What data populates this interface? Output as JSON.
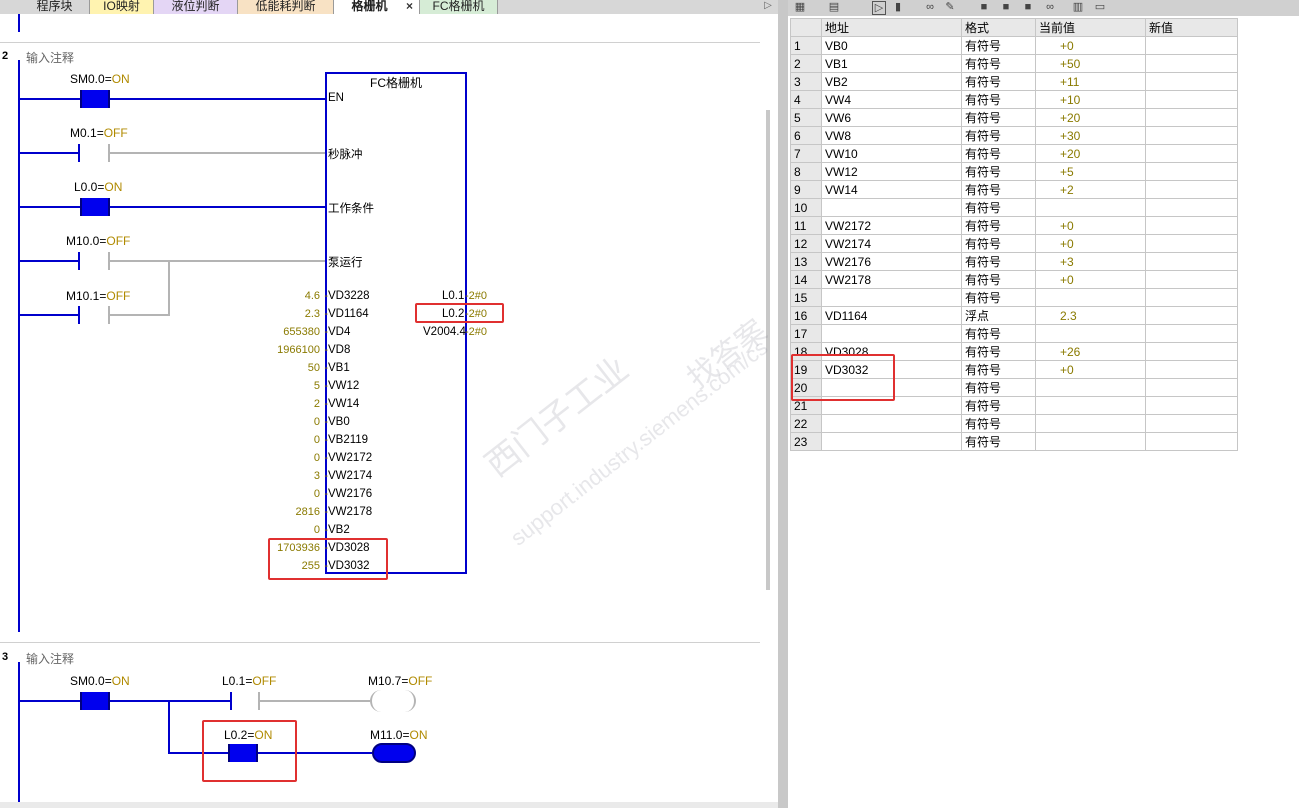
{
  "tabs": [
    {
      "label": "程序块"
    },
    {
      "label": "IO映射"
    },
    {
      "label": "液位判断"
    },
    {
      "label": "低能耗判断"
    },
    {
      "label": "格栅机",
      "close": "×"
    },
    {
      "label": "FC格栅机"
    }
  ],
  "tab_scroll": "▷",
  "networks": [
    {
      "num": "2",
      "comment": "输入注释",
      "contacts": [
        {
          "name": "SM0.0",
          "state": "ON"
        },
        {
          "name": "M0.1",
          "state": "OFF"
        },
        {
          "name": "L0.0",
          "state": "ON"
        },
        {
          "name": "M10.0",
          "state": "OFF"
        },
        {
          "name": "M10.1",
          "state": "OFF"
        }
      ],
      "fc_title": "FC格栅机",
      "inputs": [
        {
          "label": "EN"
        },
        {
          "label": "秒脉冲"
        },
        {
          "label": "工作条件"
        },
        {
          "label": "泵运行"
        }
      ],
      "params_in": [
        {
          "value": "4.6",
          "name": "VD3228"
        },
        {
          "value": "2.3",
          "name": "VD1164"
        },
        {
          "value": "655380",
          "name": "VD4"
        },
        {
          "value": "1966100",
          "name": "VD8"
        },
        {
          "value": "50",
          "name": "VB1"
        },
        {
          "value": "5",
          "name": "VW12"
        },
        {
          "value": "2",
          "name": "VW14"
        },
        {
          "value": "0",
          "name": "VB0"
        },
        {
          "value": "0",
          "name": "VB2119"
        },
        {
          "value": "0",
          "name": "VW2172"
        },
        {
          "value": "3",
          "name": "VW2174"
        },
        {
          "value": "0",
          "name": "VW2176"
        },
        {
          "value": "2816",
          "name": "VW2178"
        },
        {
          "value": "0",
          "name": "VB2"
        },
        {
          "value": "1703936",
          "name": "VD3028"
        },
        {
          "value": "255",
          "name": "VD3032"
        }
      ],
      "params_out": [
        {
          "name": "L0.1",
          "value": "2#0"
        },
        {
          "name": "L0.2",
          "value": "2#0"
        },
        {
          "name": "V2004.4",
          "value": "2#0"
        }
      ]
    },
    {
      "num": "3",
      "comment": "输入注释",
      "contacts": [
        {
          "name": "SM0.0",
          "state": "ON"
        },
        {
          "name": "L0.1",
          "state": "OFF"
        },
        {
          "name": "L0.2",
          "state": "ON"
        }
      ],
      "coils": [
        {
          "name": "M10.7",
          "state": "OFF"
        },
        {
          "name": "M11.0",
          "state": "ON"
        }
      ]
    }
  ],
  "status_table": {
    "headers": [
      "",
      "地址",
      "格式",
      "当前值",
      "新值"
    ],
    "rows": [
      {
        "n": "1",
        "addr": "VB0",
        "fmt": "有符号",
        "val": "+0"
      },
      {
        "n": "2",
        "addr": "VB1",
        "fmt": "有符号",
        "val": "+50"
      },
      {
        "n": "3",
        "addr": "VB2",
        "fmt": "有符号",
        "val": "+11"
      },
      {
        "n": "4",
        "addr": "VW4",
        "fmt": "有符号",
        "val": "+10"
      },
      {
        "n": "5",
        "addr": "VW6",
        "fmt": "有符号",
        "val": "+20"
      },
      {
        "n": "6",
        "addr": "VW8",
        "fmt": "有符号",
        "val": "+30"
      },
      {
        "n": "7",
        "addr": "VW10",
        "fmt": "有符号",
        "val": "+20"
      },
      {
        "n": "8",
        "addr": "VW12",
        "fmt": "有符号",
        "val": "+5"
      },
      {
        "n": "9",
        "addr": "VW14",
        "fmt": "有符号",
        "val": "+2"
      },
      {
        "n": "10",
        "addr": "",
        "fmt": "有符号",
        "val": ""
      },
      {
        "n": "11",
        "addr": "VW2172",
        "fmt": "有符号",
        "val": "+0"
      },
      {
        "n": "12",
        "addr": "VW2174",
        "fmt": "有符号",
        "val": "+0"
      },
      {
        "n": "13",
        "addr": "VW2176",
        "fmt": "有符号",
        "val": "+3"
      },
      {
        "n": "14",
        "addr": "VW2178",
        "fmt": "有符号",
        "val": "+0"
      },
      {
        "n": "15",
        "addr": "",
        "fmt": "有符号",
        "val": ""
      },
      {
        "n": "16",
        "addr": "VD1164",
        "fmt": "浮点",
        "val": "2.3"
      },
      {
        "n": "17",
        "addr": "",
        "fmt": "有符号",
        "val": ""
      },
      {
        "n": "18",
        "addr": "VD3028",
        "fmt": "有符号",
        "val": "+26"
      },
      {
        "n": "19",
        "addr": "VD3032",
        "fmt": "有符号",
        "val": "+0"
      },
      {
        "n": "20",
        "addr": "",
        "fmt": "有符号",
        "val": ""
      },
      {
        "n": "21",
        "addr": "",
        "fmt": "有符号",
        "val": ""
      },
      {
        "n": "22",
        "addr": "",
        "fmt": "有符号",
        "val": ""
      },
      {
        "n": "23",
        "addr": "",
        "fmt": "有符号",
        "val": ""
      }
    ]
  },
  "watermark": [
    "西门子工业",
    "support.industry.siemens.com/cs",
    "找答案"
  ],
  "colors": {
    "energized": "#0000cc",
    "off": "#b4b4b4",
    "value": "#8a7a00",
    "highlight": "#e03030"
  }
}
